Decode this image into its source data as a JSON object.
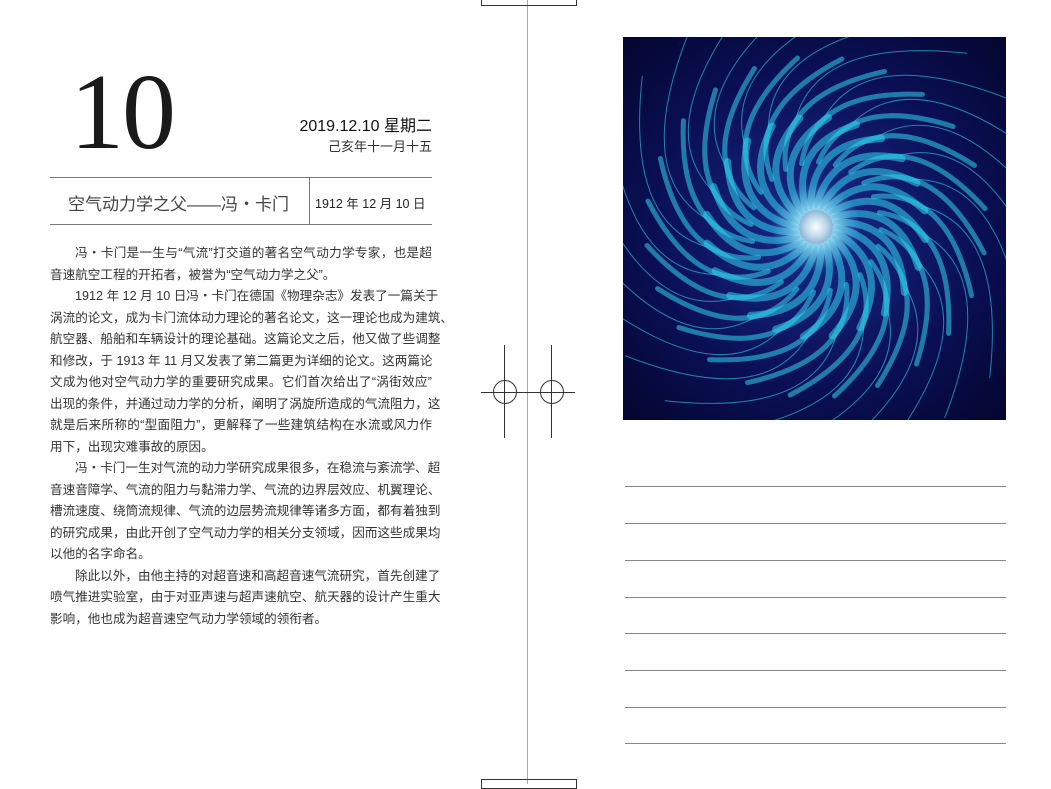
{
  "header": {
    "day_number": "10",
    "date": "2019.12.10  星期二",
    "lunar_date": "己亥年十一月十五",
    "title": "空气动力学之父——冯・卡门",
    "event_date": "1912 年 12 月 10 日"
  },
  "body": {
    "paragraphs": [
      [
        "冯・卡门是一生与“气流”打交道的著名空气动力学专家，也是超",
        "音速航空工程的开拓者，被誉为“空气动力学之父”。"
      ],
      [
        "1912 年 12 月 10 日冯・卡门在德国《物理杂志》发表了一篇关于",
        "涡流的论文，成为卡门流体动力理论的著名论文，这一理论也成为建筑、",
        "航空器、船舶和车辆设计的理论基础。这篇论文之后，他又做了些调整",
        "和修改，于 1913 年 11 月又发表了第二篇更为详细的论文。这两篇论",
        "文成为他对空气动力学的重要研究成果。它们首次给出了“涡街效应”",
        "出现的条件，并通过动力学的分析，阐明了涡旋所造成的气流阻力，这",
        "就是后来所称的“型面阻力”，更解释了一些建筑结构在水流或风力作",
        "用下，出现灾难事故的原因。"
      ],
      [
        "冯・卡门一生对气流的动力学研究成果很多，在稳流与紊流学、超",
        "音速音障学、气流的阻力与黏滞力学、气流的边界层效应、机翼理论、",
        "槽流速度、绕筒流规律、气流的边层势流规律等诸多方面，都有着独到",
        "的研究成果，由此开创了空气动力学的相关分支领域，因而这些成果均",
        "以他的名字命名。"
      ],
      [
        "除此以外，由他主持的对超音速和高超音速气流研究，首先创建了",
        "喷气推进实验室，由于对亚声速与超声速航空、航天器的设计产生重大",
        "影响，他也成为超音速空气动力学领域的领衔者。"
      ]
    ]
  },
  "colors": {
    "art_bg": "#06093a",
    "art_accent": "#2fd6f0"
  }
}
